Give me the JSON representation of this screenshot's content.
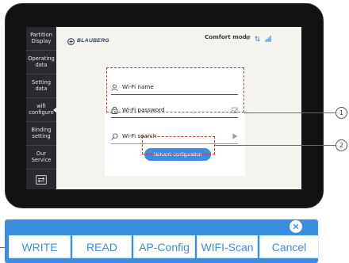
{
  "sidebar": {
    "items": [
      {
        "label": "Partition Display",
        "icon": ""
      },
      {
        "label": "Operating data"
      },
      {
        "label": "Setting data"
      },
      {
        "label": "wifi configure",
        "active": true
      },
      {
        "label": "Binding setting"
      },
      {
        "label": "Our Service"
      }
    ],
    "bottom_icon": "switch-panel-icon"
  },
  "header": {
    "brand": "BLAUBERG",
    "brand_icon": "blauberg-logo-icon",
    "mode": "Comfort mode",
    "status_icons": [
      "status-dot-icon",
      "data-transfer-icon",
      "signal-bars-icon"
    ]
  },
  "wifi_panel": {
    "name_label": "Wi-Fi name",
    "name_icon": "user-icon",
    "password_label": "Wi-Fi password",
    "password_icon": "lock-icon",
    "password_toggle_icon": "show-password-icon",
    "search_label": "Wi-Fi search",
    "search_icon": "search-icon",
    "search_go_icon": "play-arrow-icon",
    "network_button": "Network configuration"
  },
  "callouts": [
    "1",
    "2"
  ],
  "action_bar": {
    "close_icon": "close-icon",
    "buttons": [
      "WRITE",
      "READ",
      "AP-Config",
      "WIFI-Scan",
      "Cancel"
    ]
  },
  "colors": {
    "accent": "#3b8de0",
    "highlight": "#d23a3a",
    "sidebar": "#2a2a2e",
    "screen_bg": "#f5f3ee"
  }
}
